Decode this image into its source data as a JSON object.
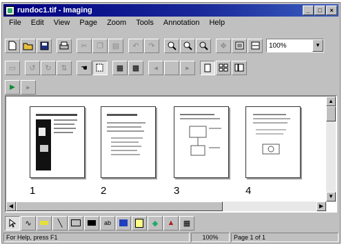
{
  "window": {
    "title": "rundoc1.tif - Imaging"
  },
  "menu": [
    "File",
    "Edit",
    "View",
    "Page",
    "Zoom",
    "Tools",
    "Annotation",
    "Help"
  ],
  "toolbar": {
    "zoom_value": "100%"
  },
  "pages": [
    {
      "label": "1"
    },
    {
      "label": "2"
    },
    {
      "label": "3"
    },
    {
      "label": "4"
    }
  ],
  "status": {
    "help": "For Help, press F1",
    "zoom": "100%",
    "page": "Page 1 of 1"
  }
}
